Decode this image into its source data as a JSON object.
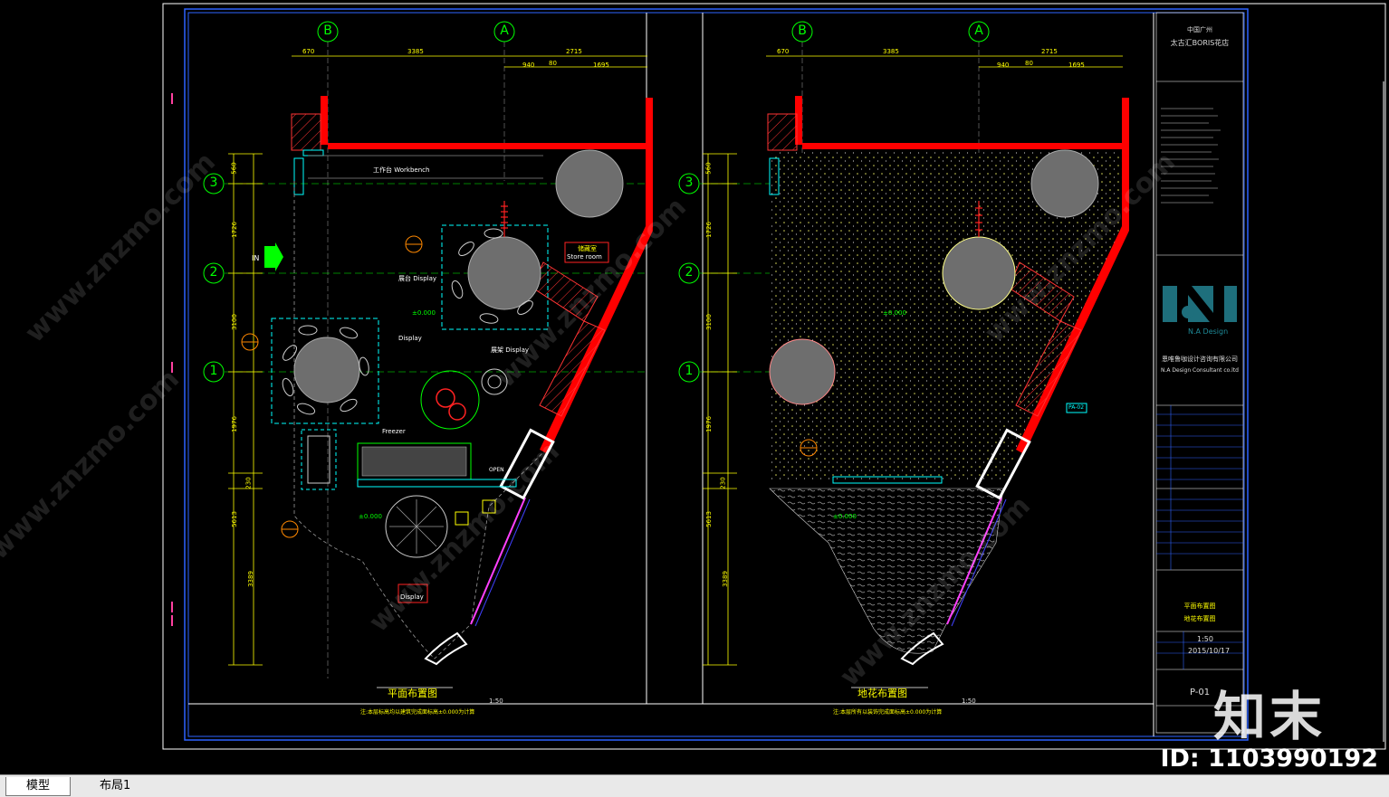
{
  "tabs": [
    {
      "label": "模型"
    },
    {
      "label": "布局1"
    }
  ],
  "grid_labels": {
    "b": "B",
    "a": "A",
    "r3": "3",
    "r2": "2",
    "r1": "1"
  },
  "left_plan": {
    "dims_top": [
      "670",
      "3385",
      "2715",
      "940",
      "80",
      "1695"
    ],
    "dims_left": [
      "560",
      "1726",
      "3100",
      "1976",
      "230",
      "5613",
      "3389"
    ],
    "workbench": "工作台 Workbench",
    "in_label": "IN",
    "store_room_cn": "储藏室",
    "store_room": "Store room",
    "display_labels": [
      "展台 Display",
      "Display",
      "展架 Display",
      "Display"
    ],
    "freezer": "Freezer",
    "open": "OPEN",
    "level": "±0.000",
    "title": "平面布置图",
    "scale": "1:50",
    "note": "注:本层标高均以建筑完成面标高±0.000为计算"
  },
  "right_plan": {
    "level": "±0.000",
    "tag": "PA-02",
    "title": "地花布置图",
    "scale": "1:50",
    "note": "注:本层所有以装饰完成面标高±0.000为计算"
  },
  "title_block": {
    "project_lines": [
      "中国广州",
      "太古汇BORIS花店"
    ],
    "company_logo": "N.A Design",
    "company_cn": "恩唯鲁咖设计咨询有限公司",
    "company_en": "N.A Design Consultant co.ltd",
    "drawing_title_lines": [
      "平面布置图",
      "地花布置图"
    ],
    "scale": "1:50",
    "date": "2015/10/17",
    "sheet_no": "P-01"
  },
  "watermark": {
    "site": "www.znzmo.com",
    "brand": "知末",
    "id": "ID: 1103990192"
  },
  "colors": {
    "wall": "#ff0000",
    "dim": "#ffff00",
    "grid": "#00ff00",
    "frame": "#2e63ff",
    "column": "#6e6e6e",
    "cyan": "#00ffff"
  }
}
